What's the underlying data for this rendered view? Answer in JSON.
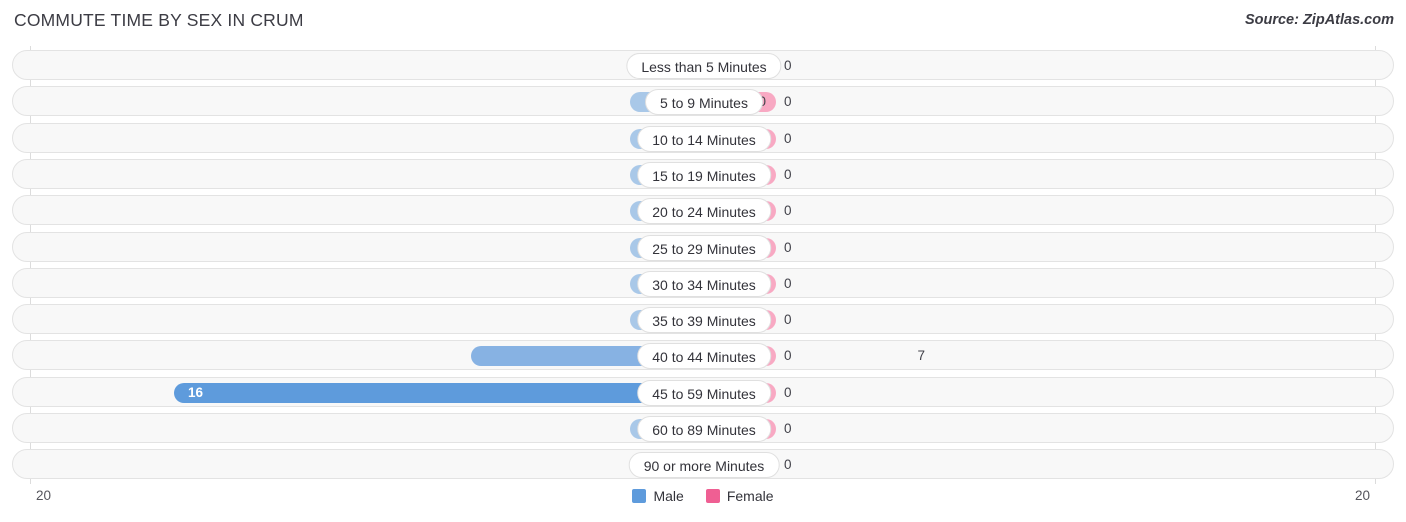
{
  "header": {
    "title": "COMMUTE TIME BY SEX IN CRUM",
    "source": "Source: ZipAtlas.com"
  },
  "footer": {
    "axis_left": "20",
    "axis_right": "20"
  },
  "legend": {
    "items": [
      {
        "label": "Male",
        "color": "#5e9bdc"
      },
      {
        "label": "Female",
        "color": "#ef5f93"
      }
    ]
  },
  "colors": {
    "male_zero": "#a9c8e8",
    "male_mid": "#87b2e3",
    "male_high": "#5e9bdc",
    "female_zero": "#f8a9c3",
    "track": "#f8f8f8",
    "track_border": "#e3e3e3",
    "gridline": "#dcdcdc"
  },
  "chart_data": {
    "type": "bar",
    "title": "COMMUTE TIME BY SEX IN CRUM",
    "subtitle": "",
    "xlabel": "",
    "ylabel": "",
    "orientation": "horizontal-diverging",
    "axis_max_left": 20,
    "axis_max_right": 20,
    "xlim": [
      20,
      20
    ],
    "grid": true,
    "legend_position": "bottom-center",
    "categories": [
      "Less than 5 Minutes",
      "5 to 9 Minutes",
      "10 to 14 Minutes",
      "15 to 19 Minutes",
      "20 to 24 Minutes",
      "25 to 29 Minutes",
      "30 to 34 Minutes",
      "35 to 39 Minutes",
      "40 to 44 Minutes",
      "45 to 59 Minutes",
      "60 to 89 Minutes",
      "90 or more Minutes"
    ],
    "series": [
      {
        "name": "Male",
        "color": "#5e9bdc",
        "values": [
          0,
          0,
          0,
          0,
          0,
          0,
          0,
          0,
          7,
          16,
          0,
          0
        ]
      },
      {
        "name": "Female",
        "color": "#ef5f93",
        "values": [
          0,
          0,
          0,
          0,
          0,
          0,
          0,
          0,
          0,
          0,
          0,
          0
        ]
      }
    ]
  },
  "rows": [
    {
      "category": "Less than 5 Minutes",
      "male": "0",
      "female": "0"
    },
    {
      "category": "5 to 9 Minutes",
      "male": "0",
      "female": "0"
    },
    {
      "category": "10 to 14 Minutes",
      "male": "0",
      "female": "0"
    },
    {
      "category": "15 to 19 Minutes",
      "male": "0",
      "female": "0"
    },
    {
      "category": "20 to 24 Minutes",
      "male": "0",
      "female": "0"
    },
    {
      "category": "25 to 29 Minutes",
      "male": "0",
      "female": "0"
    },
    {
      "category": "30 to 34 Minutes",
      "male": "0",
      "female": "0"
    },
    {
      "category": "35 to 39 Minutes",
      "male": "0",
      "female": "0"
    },
    {
      "category": "40 to 44 Minutes",
      "male": "7",
      "female": "0"
    },
    {
      "category": "45 to 59 Minutes",
      "male": "16",
      "female": "0"
    },
    {
      "category": "60 to 89 Minutes",
      "male": "0",
      "female": "0"
    },
    {
      "category": "90 or more Minutes",
      "male": "0",
      "female": "0"
    }
  ]
}
